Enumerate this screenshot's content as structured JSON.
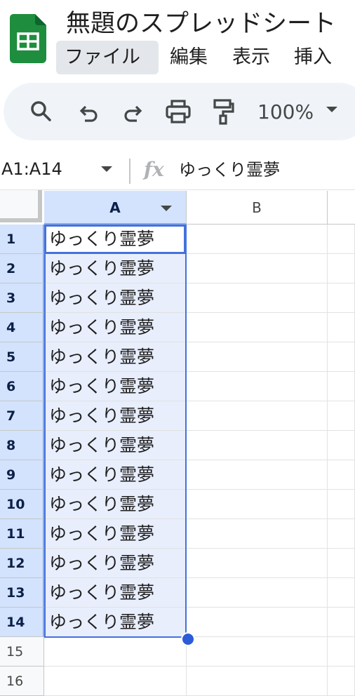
{
  "app": {
    "title": "無題のスプレッドシート",
    "brand_color": "#1e8e3e"
  },
  "menu": {
    "items": [
      {
        "label": "ファイル",
        "active": true
      },
      {
        "label": "編集",
        "active": false
      },
      {
        "label": "表示",
        "active": false
      },
      {
        "label": "挿入",
        "active": false
      }
    ]
  },
  "toolbar": {
    "buttons": [
      {
        "icon": "search-icon"
      },
      {
        "icon": "undo-icon"
      },
      {
        "icon": "redo-icon"
      },
      {
        "icon": "print-icon"
      },
      {
        "icon": "paint-format-icon"
      }
    ],
    "zoom": "100%"
  },
  "formula_bar": {
    "name_box": "A1:A14",
    "fx_label": "fx",
    "content": "ゆっくり霊夢"
  },
  "grid": {
    "columns": [
      "A",
      "B"
    ],
    "selected_column": "A",
    "rows": [
      {
        "num": "1",
        "a": "ゆっくり霊夢"
      },
      {
        "num": "2",
        "a": "ゆっくり霊夢"
      },
      {
        "num": "3",
        "a": "ゆっくり霊夢"
      },
      {
        "num": "4",
        "a": "ゆっくり霊夢"
      },
      {
        "num": "5",
        "a": "ゆっくり霊夢"
      },
      {
        "num": "6",
        "a": "ゆっくり霊夢"
      },
      {
        "num": "7",
        "a": "ゆっくり霊夢"
      },
      {
        "num": "8",
        "a": "ゆっくり霊夢"
      },
      {
        "num": "9",
        "a": "ゆっくり霊夢"
      },
      {
        "num": "10",
        "a": "ゆっくり霊夢"
      },
      {
        "num": "11",
        "a": "ゆっくり霊夢"
      },
      {
        "num": "12",
        "a": "ゆっくり霊夢"
      },
      {
        "num": "13",
        "a": "ゆっくり霊夢"
      },
      {
        "num": "14",
        "a": "ゆっくり霊夢"
      },
      {
        "num": "15",
        "a": ""
      },
      {
        "num": "16",
        "a": ""
      }
    ],
    "selection_color": "#4472db"
  }
}
